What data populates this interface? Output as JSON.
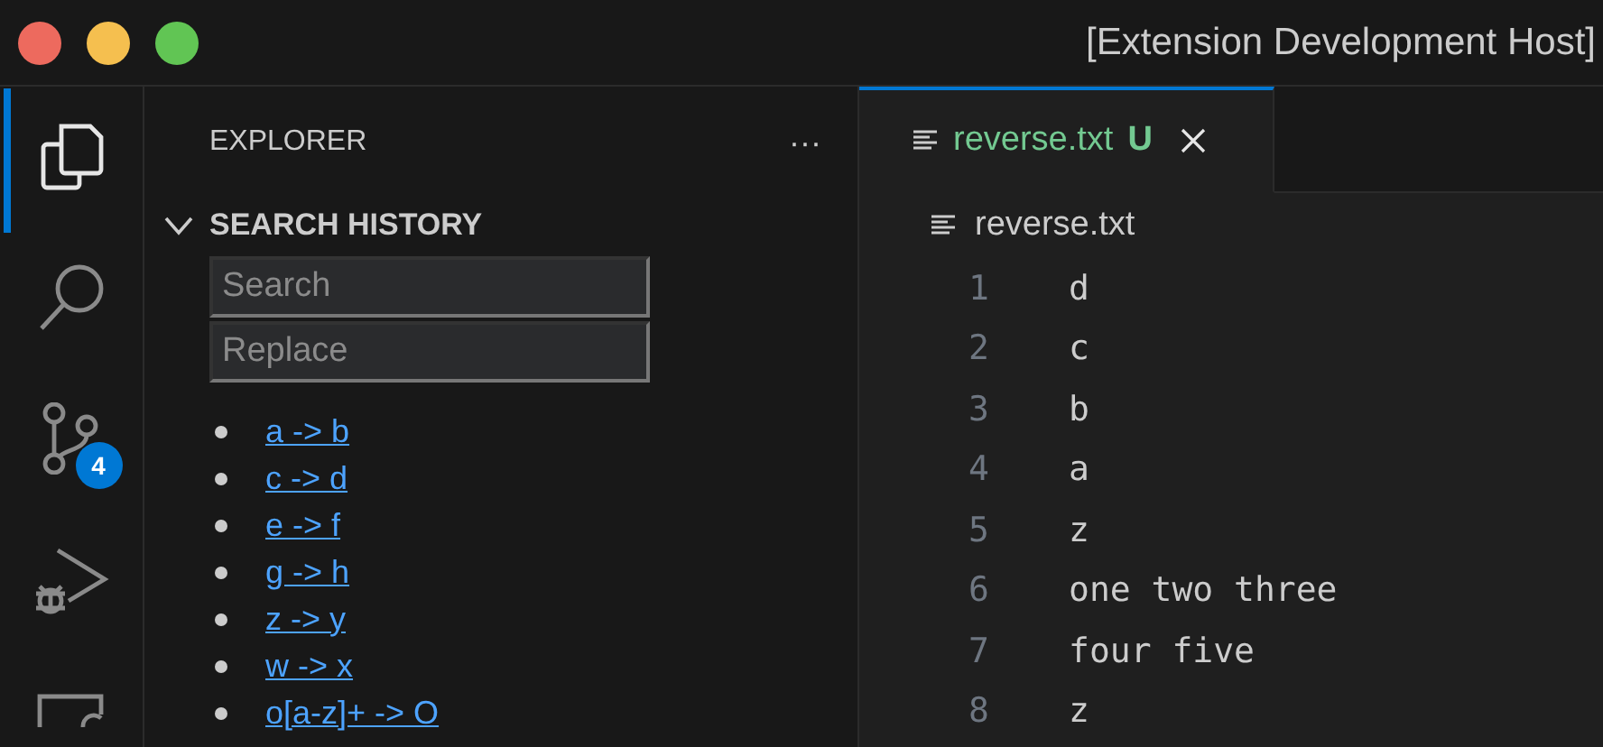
{
  "window": {
    "title": "[Extension Development Host]"
  },
  "activity_bar": [
    {
      "kind": "explorer",
      "selected": true
    },
    {
      "kind": "search",
      "selected": false
    },
    {
      "kind": "source-control",
      "selected": false,
      "badge": "4"
    },
    {
      "kind": "run-debug",
      "selected": false
    },
    {
      "kind": "remote",
      "selected": false
    }
  ],
  "sidebar": {
    "title": "EXPLORER",
    "more": "···",
    "section": {
      "title": "SEARCH HISTORY",
      "expanded": true,
      "search": {
        "placeholder": "Search"
      },
      "replace": {
        "placeholder": "Replace"
      },
      "history": [
        "a -> b",
        "c -> d",
        "e -> f",
        "g -> h",
        "z -> y",
        "w -> x",
        "o[a-z]+ -> O"
      ]
    }
  },
  "tabs": [
    {
      "label": "reverse.txt",
      "status": "U",
      "selected": true
    }
  ],
  "breadcrumb": "reverse.txt",
  "lines": [
    {
      "number": "1",
      "text": "d"
    },
    {
      "number": "2",
      "text": "c"
    },
    {
      "number": "3",
      "text": "b"
    },
    {
      "number": "4",
      "text": "a"
    },
    {
      "number": "5",
      "text": "z"
    },
    {
      "number": "6",
      "text": "one two three"
    },
    {
      "number": "7",
      "text": "four five"
    },
    {
      "number": "8",
      "text": "z"
    }
  ]
}
